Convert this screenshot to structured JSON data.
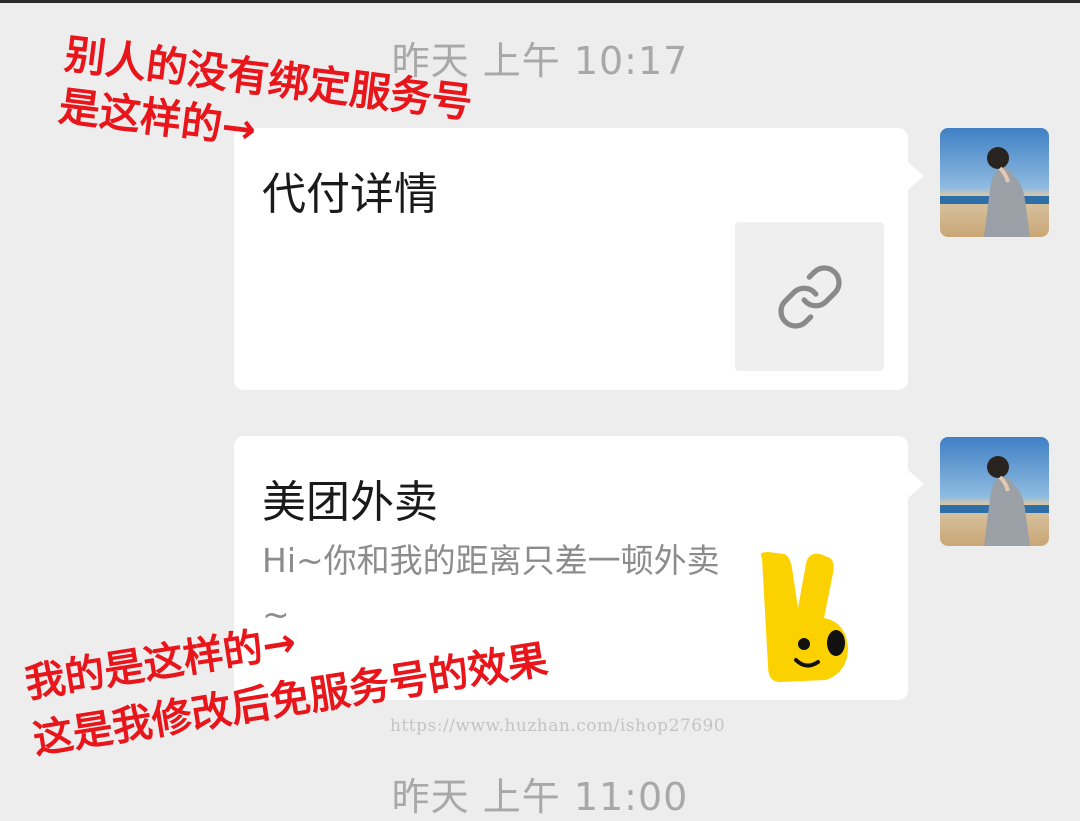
{
  "timestamps": {
    "top": "昨天 上午 10:17",
    "bottom": "昨天 上午 11:00"
  },
  "messages": [
    {
      "title": "代付详情",
      "description": "",
      "thumbnail_icon": "link-icon"
    },
    {
      "title": "美团外卖",
      "description": "Hi~你和我的距离只差一顿外卖~",
      "thumbnail_icon": "meituan-mascot-icon"
    }
  ],
  "annotations": {
    "top_line1": "别人的没有绑定服务号",
    "top_line2": "是这样的→",
    "bottom_line1": "我的是这样的→",
    "bottom_line2": "这是我修改后免服务号的效果"
  },
  "watermark": "https://www.huzhan.com/ishop27690",
  "colors": {
    "background": "#ededed",
    "bubble": "#ffffff",
    "annotation": "#e8151b",
    "timestamp": "#a8a8a8",
    "mascot": "#fcd100"
  }
}
